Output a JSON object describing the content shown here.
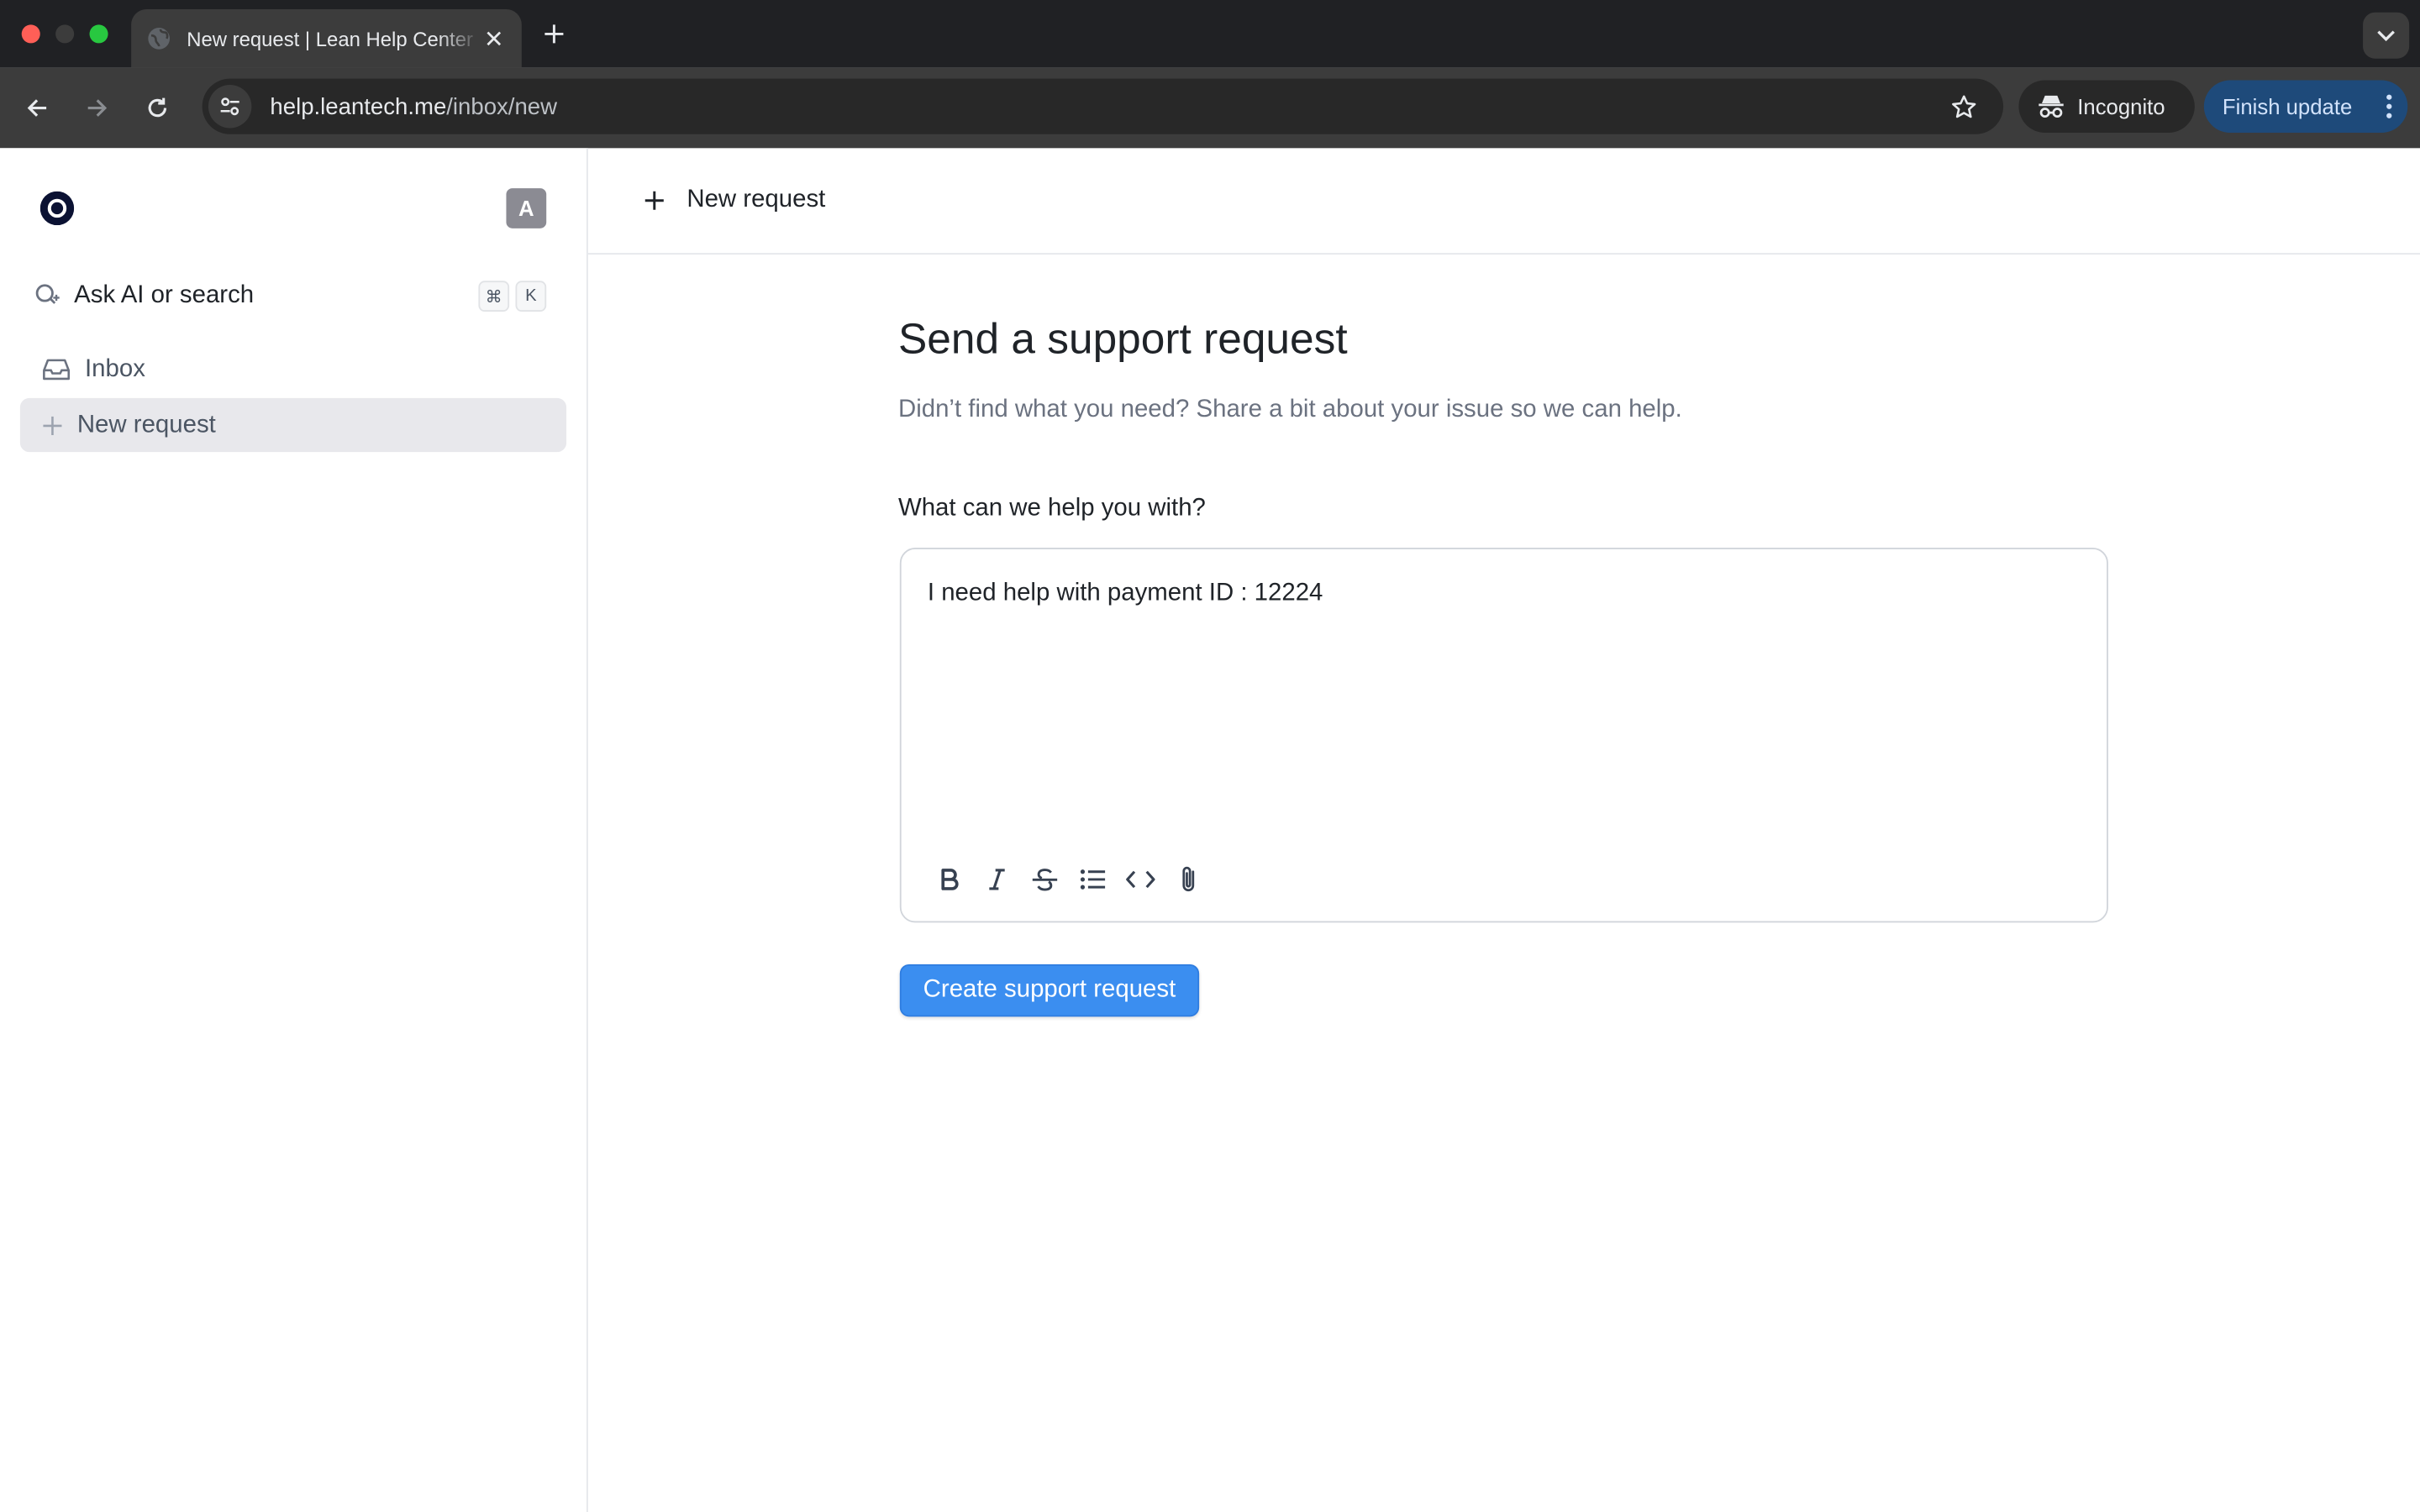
{
  "browser": {
    "tab_title": "New request | Lean Help Center",
    "url_host": "help.leantech.me",
    "url_path": "/inbox/new",
    "incognito_label": "Incognito",
    "finish_update_label": "Finish update"
  },
  "sidebar": {
    "avatar_initial": "A",
    "search_label": "Ask AI or search",
    "search_shortcut": [
      "⌘",
      "K"
    ],
    "items": [
      {
        "label": "Inbox",
        "icon": "inbox-icon",
        "active": false
      },
      {
        "label": "New request",
        "icon": "plus-icon",
        "active": true
      }
    ]
  },
  "header": {
    "new_request_label": "New request"
  },
  "form": {
    "title": "Send a support request",
    "subtitle": "Didn’t find what you need? Share a bit about your issue so we can help.",
    "field_label": "What can we help you with?",
    "message_value": "I need help with payment ID : 12224",
    "toolbar_tools": [
      "bold-icon",
      "italic-icon",
      "strikethrough-icon",
      "bullet-list-icon",
      "code-icon",
      "attachment-icon"
    ],
    "submit_label": "Create support request"
  },
  "colors": {
    "primary_button": "#3b8ef0",
    "active_nav_bg": "#e8e8ec",
    "finish_update_bg": "#1e4a7a"
  }
}
